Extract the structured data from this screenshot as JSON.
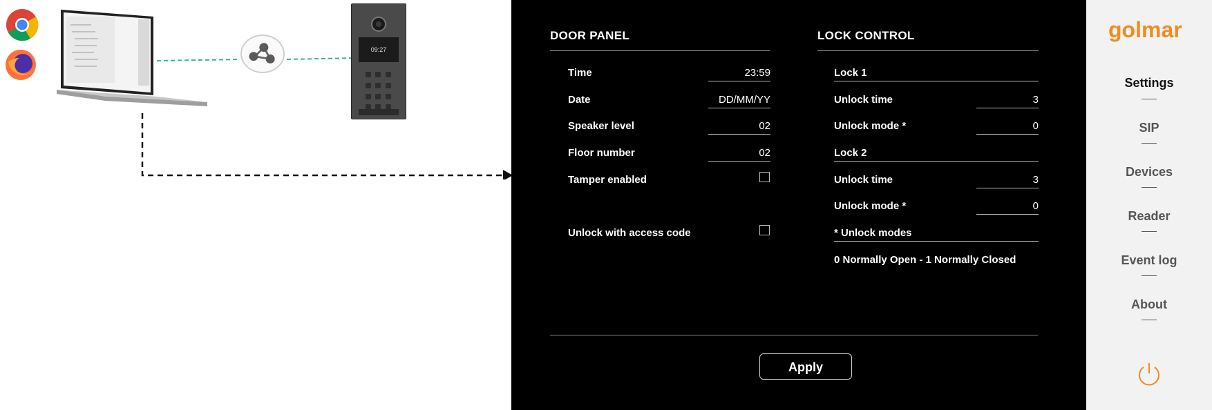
{
  "illustration": {
    "device_time": "09:27"
  },
  "door_panel": {
    "title": "DOOR PANEL",
    "rows": [
      {
        "label": "Time",
        "value": "23:59"
      },
      {
        "label": "Date",
        "value": "DD/MM/YY"
      },
      {
        "label": "Speaker level",
        "value": "02"
      },
      {
        "label": "Floor number",
        "value": "02"
      }
    ],
    "tamper_label": "Tamper enabled",
    "tamper_checked": false,
    "access_code_label": "Unlock with access code",
    "access_code_checked": false
  },
  "lock_control": {
    "title": "LOCK CONTROL",
    "lock1": {
      "heading": "Lock 1",
      "unlock_time_label": "Unlock time",
      "unlock_time_value": "3",
      "unlock_mode_label": "Unlock mode *",
      "unlock_mode_value": "0"
    },
    "lock2": {
      "heading": "Lock 2",
      "unlock_time_label": "Unlock time",
      "unlock_time_value": "3",
      "unlock_mode_label": "Unlock mode *",
      "unlock_mode_value": "0"
    },
    "modes_heading": "* Unlock modes",
    "modes_note": "0 Normally Open - 1 Normally Closed"
  },
  "actions": {
    "apply_label": "Apply"
  },
  "sidebar": {
    "brand": "golmar",
    "brand_color": "#f08c22",
    "items": [
      {
        "label": "Settings",
        "active": true
      },
      {
        "label": "SIP",
        "active": false
      },
      {
        "label": "Devices",
        "active": false
      },
      {
        "label": "Reader",
        "active": false
      },
      {
        "label": "Event log",
        "active": false
      },
      {
        "label": "About",
        "active": false
      }
    ],
    "power_icon": "power-icon"
  }
}
